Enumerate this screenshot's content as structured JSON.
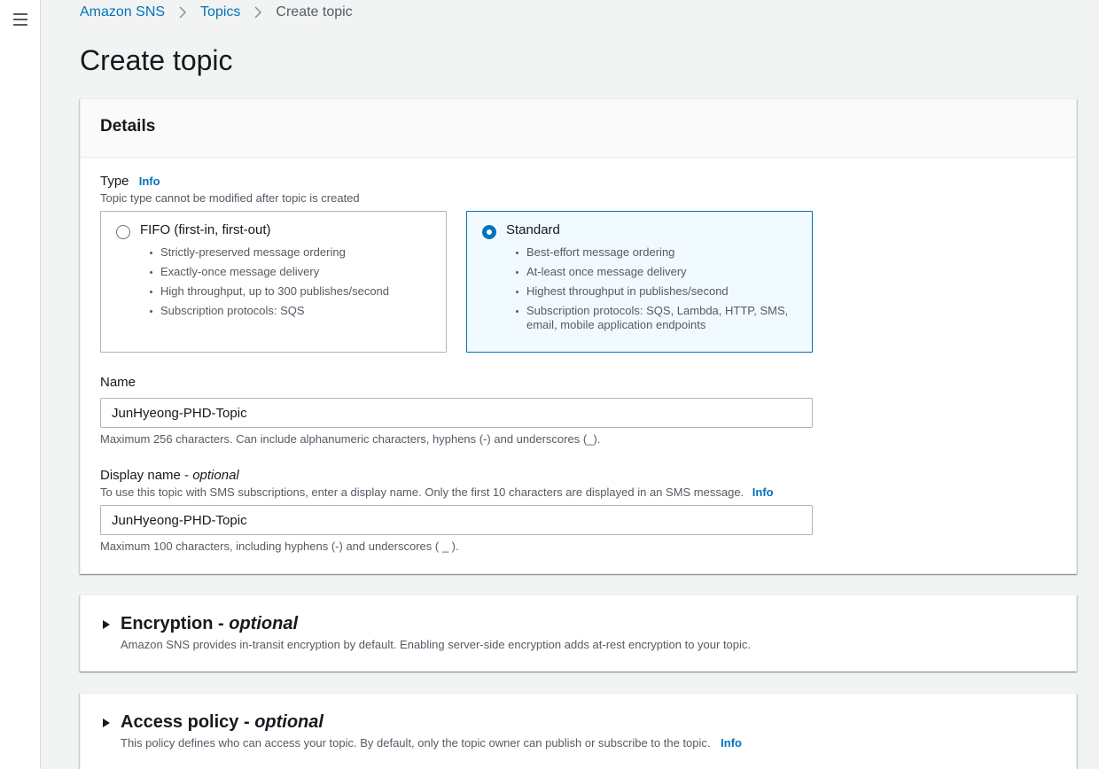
{
  "breadcrumb": {
    "items": [
      "Amazon SNS",
      "Topics"
    ],
    "current": "Create topic"
  },
  "page_title": "Create topic",
  "details": {
    "header": "Details",
    "type_label": "Type",
    "type_info": "Info",
    "type_desc": "Topic type cannot be modified after topic is created",
    "options": [
      {
        "title": "FIFO (first-in, first-out)",
        "selected": false,
        "bullets": [
          "Strictly-preserved message ordering",
          "Exactly-once message delivery",
          "High throughput, up to 300 publishes/second",
          "Subscription protocols: SQS"
        ]
      },
      {
        "title": "Standard",
        "selected": true,
        "bullets": [
          "Best-effort message ordering",
          "At-least once message delivery",
          "Highest throughput in publishes/second",
          "Subscription protocols: SQS, Lambda, HTTP, SMS, email, mobile application endpoints"
        ]
      }
    ],
    "name_label": "Name",
    "name_value": "JunHyeong-PHD-Topic",
    "name_constraint": "Maximum 256 characters. Can include alphanumeric characters, hyphens (-) and underscores (_).",
    "display_label": "Display name - ",
    "display_optional": "optional",
    "display_desc": "To use this topic with SMS subscriptions, enter a display name. Only the first 10 characters are displayed in an SMS message.",
    "display_info": "Info",
    "display_value": "JunHyeong-PHD-Topic",
    "display_constraint": "Maximum 100 characters, including hyphens (-) and underscores ( _ )."
  },
  "encryption": {
    "title": "Encryption - ",
    "optional": "optional",
    "desc": "Amazon SNS provides in-transit encryption by default. Enabling server-side encryption adds at-rest encryption to your topic."
  },
  "access_policy": {
    "title": "Access policy - ",
    "optional": "optional",
    "desc": "This policy defines who can access your topic. By default, only the topic owner can publish or subscribe to the topic.",
    "info": "Info"
  },
  "colors": {
    "link": "#0073bb",
    "selected_bg": "#f1faff",
    "page_bg": "#f2f3f3"
  }
}
